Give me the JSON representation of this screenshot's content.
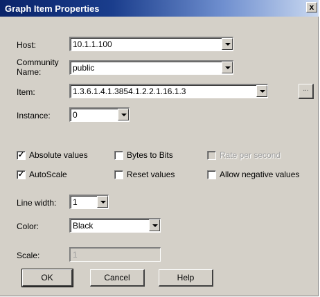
{
  "window": {
    "title": "Graph Item Properties",
    "close_label": "x"
  },
  "fields": {
    "host": {
      "label": "Host:",
      "value": "10.1.1.100"
    },
    "community": {
      "label_line1": "Community",
      "label_line2": "Name:",
      "value": "public"
    },
    "item": {
      "label": "Item:",
      "value": "1.3.6.1.4.1.3854.1.2.2.1.16.1.3",
      "browse_label": "..."
    },
    "instance": {
      "label": "Instance:",
      "value": "0"
    }
  },
  "checkboxes": {
    "absolute_values": {
      "label": "Absolute values",
      "checked": true,
      "mark": "✓"
    },
    "bytes_to_bits": {
      "label": "Bytes to Bits",
      "checked": false,
      "mark": ""
    },
    "rate_per_second": {
      "label": "Rate per second",
      "checked": false,
      "disabled": true,
      "mark": ""
    },
    "autoscale": {
      "label": "AutoScale",
      "checked": true,
      "mark": "✓"
    },
    "reset_values": {
      "label": "Reset values",
      "checked": false,
      "mark": ""
    },
    "allow_negative": {
      "label": "Allow negative values",
      "checked": false,
      "mark": ""
    }
  },
  "line_width": {
    "label": "Line width:",
    "value": "1"
  },
  "color": {
    "label": "Color:",
    "value": "Black"
  },
  "scale": {
    "label": "Scale:",
    "value": "1"
  },
  "buttons": {
    "ok": "OK",
    "cancel": "Cancel",
    "help": "Help"
  }
}
